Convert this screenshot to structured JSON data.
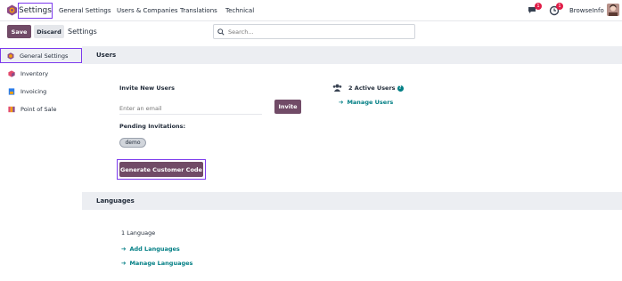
{
  "navbar": {
    "app_title": "Settings",
    "menu": [
      "General Settings",
      "Users & Companies",
      "Translations",
      "Technical"
    ],
    "messages_badge": "1",
    "activity_badge": "1",
    "company": "BrowseInfo"
  },
  "control": {
    "save_label": "Save",
    "discard_label": "Discard",
    "breadcrumb": "Settings",
    "search_placeholder": "Search..."
  },
  "sidebar": {
    "items": [
      {
        "label": "General Settings",
        "icon": "general-settings-icon",
        "color": "#e46f35"
      },
      {
        "label": "Inventory",
        "icon": "inventory-icon",
        "color": "#e34b6c"
      },
      {
        "label": "Invoicing",
        "icon": "invoicing-icon",
        "color": "#2b7de9"
      },
      {
        "label": "Point of Sale",
        "icon": "point-of-sale-icon",
        "color": "#d8772b"
      }
    ]
  },
  "users_section": {
    "title": "Users",
    "invite_heading": "Invite New Users",
    "email_placeholder": "Enter an email",
    "invite_label": "Invite",
    "pending_heading": "Pending Invitations:",
    "pending_tag": "demo",
    "generate_label": "Generate Customer Code",
    "active_users": "2 Active Users",
    "manage_users": "Manage Users"
  },
  "languages_section": {
    "title": "Languages",
    "count": "1 Language",
    "add_languages": "Add Languages",
    "manage_languages": "Manage Languages"
  },
  "colors": {
    "primary": "#714b67",
    "link": "#017e84",
    "highlight": "#7c3aed"
  }
}
